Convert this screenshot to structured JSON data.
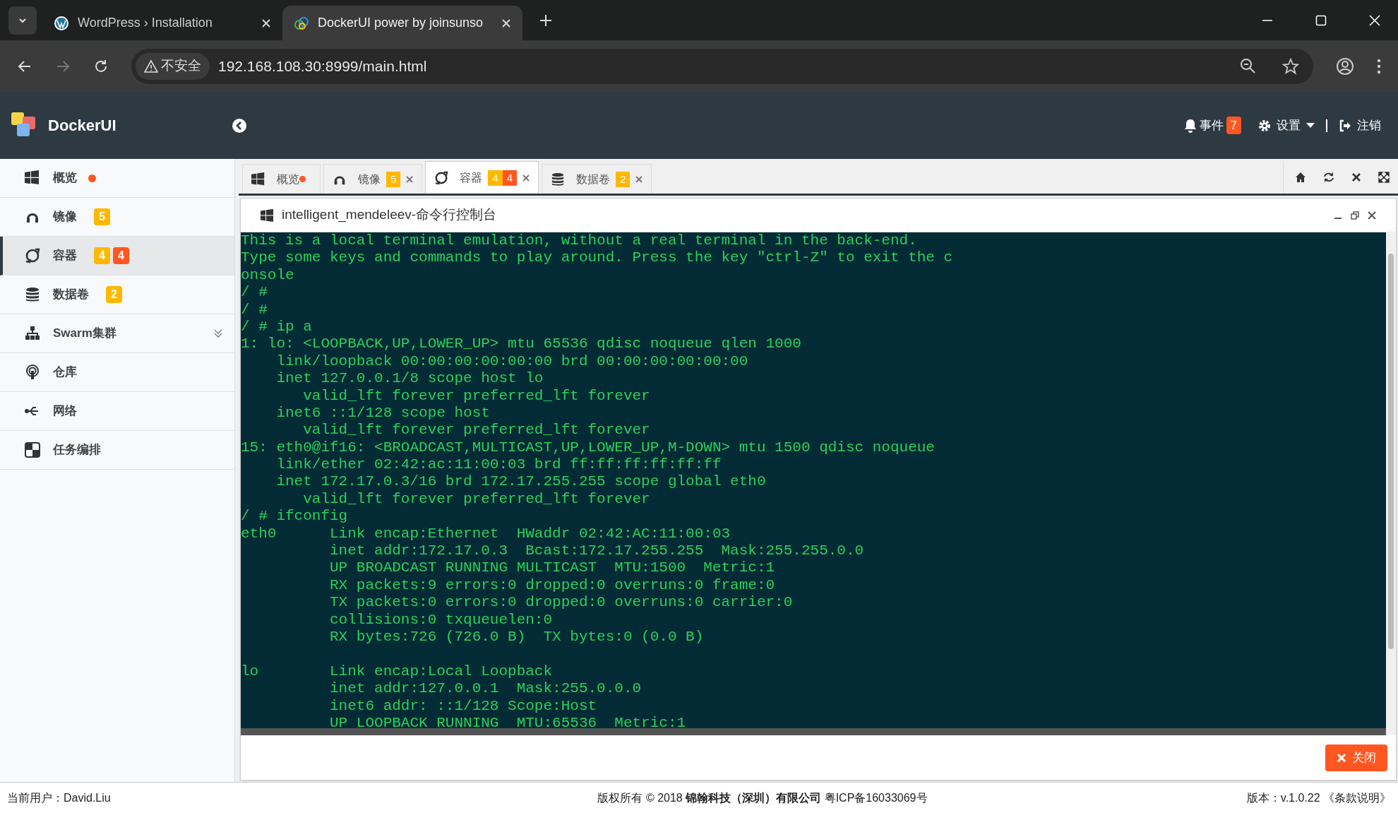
{
  "browser": {
    "tabs": [
      {
        "title": "WordPress › Installation",
        "selected": false
      },
      {
        "title": "DockerUI power by joinsunso",
        "selected": true
      }
    ],
    "address": "192.168.108.30:8999/main.html",
    "security_label": "不安全"
  },
  "header": {
    "app_name": "DockerUI",
    "events_label": "事件",
    "events_count": "7",
    "settings_label": "设置",
    "logout_label": "注销"
  },
  "sidebar": {
    "items": [
      {
        "label": "概览",
        "selected": false,
        "dot": true
      },
      {
        "label": "镜像",
        "selected": false,
        "badges": [
          {
            "text": "5",
            "color": "#ffb800"
          }
        ]
      },
      {
        "label": "容器",
        "selected": true,
        "badges": [
          {
            "text": "4",
            "color": "#ffb800"
          },
          {
            "text": "4",
            "color": "#ff5722"
          }
        ]
      },
      {
        "label": "数据卷",
        "selected": false,
        "badges": [
          {
            "text": "2",
            "color": "#ffb800"
          }
        ]
      },
      {
        "label": "Swarm集群",
        "selected": false,
        "expandable": true
      },
      {
        "label": "仓库",
        "selected": false
      },
      {
        "label": "网络",
        "selected": false
      },
      {
        "label": "任务编排",
        "selected": false
      }
    ]
  },
  "tabs": [
    {
      "label": "概览",
      "selected": false,
      "dot": true,
      "closable": false
    },
    {
      "label": "镜像",
      "selected": false,
      "closable": true,
      "badges": [
        {
          "text": "5",
          "color": "#ffb800"
        }
      ]
    },
    {
      "label": "容器",
      "selected": true,
      "closable": true,
      "badges": [
        {
          "text": "4",
          "color": "#ffb800"
        },
        {
          "text": "4",
          "color": "#ff5722"
        }
      ]
    },
    {
      "label": "数据卷",
      "selected": false,
      "closable": true,
      "badges": [
        {
          "text": "2",
          "color": "#ffb800"
        }
      ]
    }
  ],
  "panel": {
    "title": "intelligent_mendeleev-命令行控制台",
    "close_button": "关闭"
  },
  "terminal": {
    "lines": [
      "This is a local terminal emulation, without a real terminal in the back-end.",
      "Type some keys and commands to play around. Press the key \"ctrl-Z\" to exit the c",
      "onsole",
      "/ #",
      "/ #",
      "/ # ip a",
      "1: lo: <LOOPBACK,UP,LOWER_UP> mtu 65536 qdisc noqueue qlen 1000",
      "    link/loopback 00:00:00:00:00:00 brd 00:00:00:00:00:00",
      "    inet 127.0.0.1/8 scope host lo",
      "       valid_lft forever preferred_lft forever",
      "    inet6 ::1/128 scope host",
      "       valid_lft forever preferred_lft forever",
      "15: eth0@if16: <BROADCAST,MULTICAST,UP,LOWER_UP,M-DOWN> mtu 1500 qdisc noqueue",
      "    link/ether 02:42:ac:11:00:03 brd ff:ff:ff:ff:ff:ff",
      "    inet 172.17.0.3/16 brd 172.17.255.255 scope global eth0",
      "       valid_lft forever preferred_lft forever",
      "/ # ifconfig",
      "eth0      Link encap:Ethernet  HWaddr 02:42:AC:11:00:03",
      "          inet addr:172.17.0.3  Bcast:172.17.255.255  Mask:255.255.0.0",
      "          UP BROADCAST RUNNING MULTICAST  MTU:1500  Metric:1",
      "          RX packets:9 errors:0 dropped:0 overruns:0 frame:0",
      "          TX packets:0 errors:0 dropped:0 overruns:0 carrier:0",
      "          collisions:0 txqueuelen:0",
      "          RX bytes:726 (726.0 B)  TX bytes:0 (0.0 B)",
      {
        "text": "lo        Link encap:Local Loopback",
        "blank_before": true
      },
      "          inet addr:127.0.0.1  Mask:255.0.0.0",
      "          inet6 addr: ::1/128 Scope:Host",
      "          UP LOOPBACK RUNNING  MTU:65536  Metric:1"
    ]
  },
  "status_bar": {
    "user": "当前用户：David.Liu",
    "copyright": "版权所有 © 2018 **锦翰科技（深圳）有限公司** 粤ICP备16033069号",
    "version": "版本：v.1.0.22 《条款说明》"
  }
}
